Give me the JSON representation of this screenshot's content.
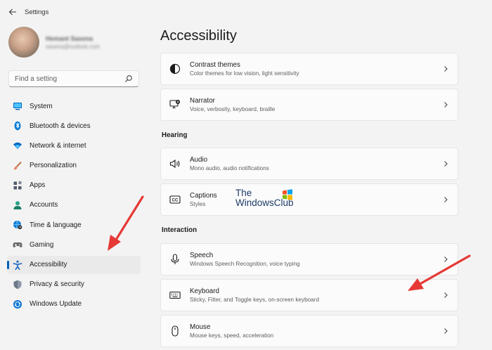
{
  "titlebar": {
    "title": "Settings",
    "back_icon": "back-arrow-icon"
  },
  "profile": {
    "name": "Hemant Saxena",
    "email": "saxena@outlook.com"
  },
  "search": {
    "placeholder": "Find a setting",
    "icon": "search-icon"
  },
  "sidebar": {
    "items": [
      {
        "label": "System",
        "icon": "system-monitor-icon",
        "color": "#0067c0",
        "active": false
      },
      {
        "label": "Bluetooth & devices",
        "icon": "bluetooth-icon",
        "color": "#0078d4",
        "active": false
      },
      {
        "label": "Network & internet",
        "icon": "wifi-icon",
        "color": "#0067c0",
        "active": false
      },
      {
        "label": "Personalization",
        "icon": "paintbrush-icon",
        "color": "#e3825a",
        "active": false
      },
      {
        "label": "Apps",
        "icon": "apps-icon",
        "color": "#505a6b",
        "active": false
      },
      {
        "label": "Accounts",
        "icon": "person-icon",
        "color": "#2aa387",
        "active": false
      },
      {
        "label": "Time & language",
        "icon": "globe-clock-icon",
        "color": "#0a7bd4",
        "active": false
      },
      {
        "label": "Gaming",
        "icon": "gamepad-icon",
        "color": "#6a6a6a",
        "active": false
      },
      {
        "label": "Accessibility",
        "icon": "accessibility-icon",
        "color": "#1565c0",
        "active": true
      },
      {
        "label": "Privacy & security",
        "icon": "shield-icon",
        "color": "#6c7788",
        "active": false
      },
      {
        "label": "Windows Update",
        "icon": "update-icon",
        "color": "#0a74d4",
        "active": false
      }
    ]
  },
  "main": {
    "title": "Accessibility",
    "sections": [
      {
        "label": "",
        "cards": [
          {
            "title": "Contrast themes",
            "subtitle": "Color themes for low vision, light sensitivity",
            "icon": "contrast-icon"
          },
          {
            "title": "Narrator",
            "subtitle": "Voice, verbosity, keyboard, braille",
            "icon": "narrator-icon"
          }
        ]
      },
      {
        "label": "Hearing",
        "cards": [
          {
            "title": "Audio",
            "subtitle": "Mono audio, audio notifications",
            "icon": "speaker-icon"
          },
          {
            "title": "Captions",
            "subtitle": "Styles",
            "icon": "captions-icon"
          }
        ]
      },
      {
        "label": "Interaction",
        "cards": [
          {
            "title": "Speech",
            "subtitle": "Windows Speech Recognition, voice typing",
            "icon": "microphone-icon"
          },
          {
            "title": "Keyboard",
            "subtitle": "Sticky, Filter, and Toggle keys, on-screen keyboard",
            "icon": "keyboard-icon"
          },
          {
            "title": "Mouse",
            "subtitle": "Mouse keys, speed, acceleration",
            "icon": "mouse-icon"
          }
        ]
      }
    ]
  },
  "watermark": {
    "line1": "The",
    "line2": "WindowsClub"
  },
  "annotation_color": "#e53935",
  "accent_color": "#005fb8"
}
